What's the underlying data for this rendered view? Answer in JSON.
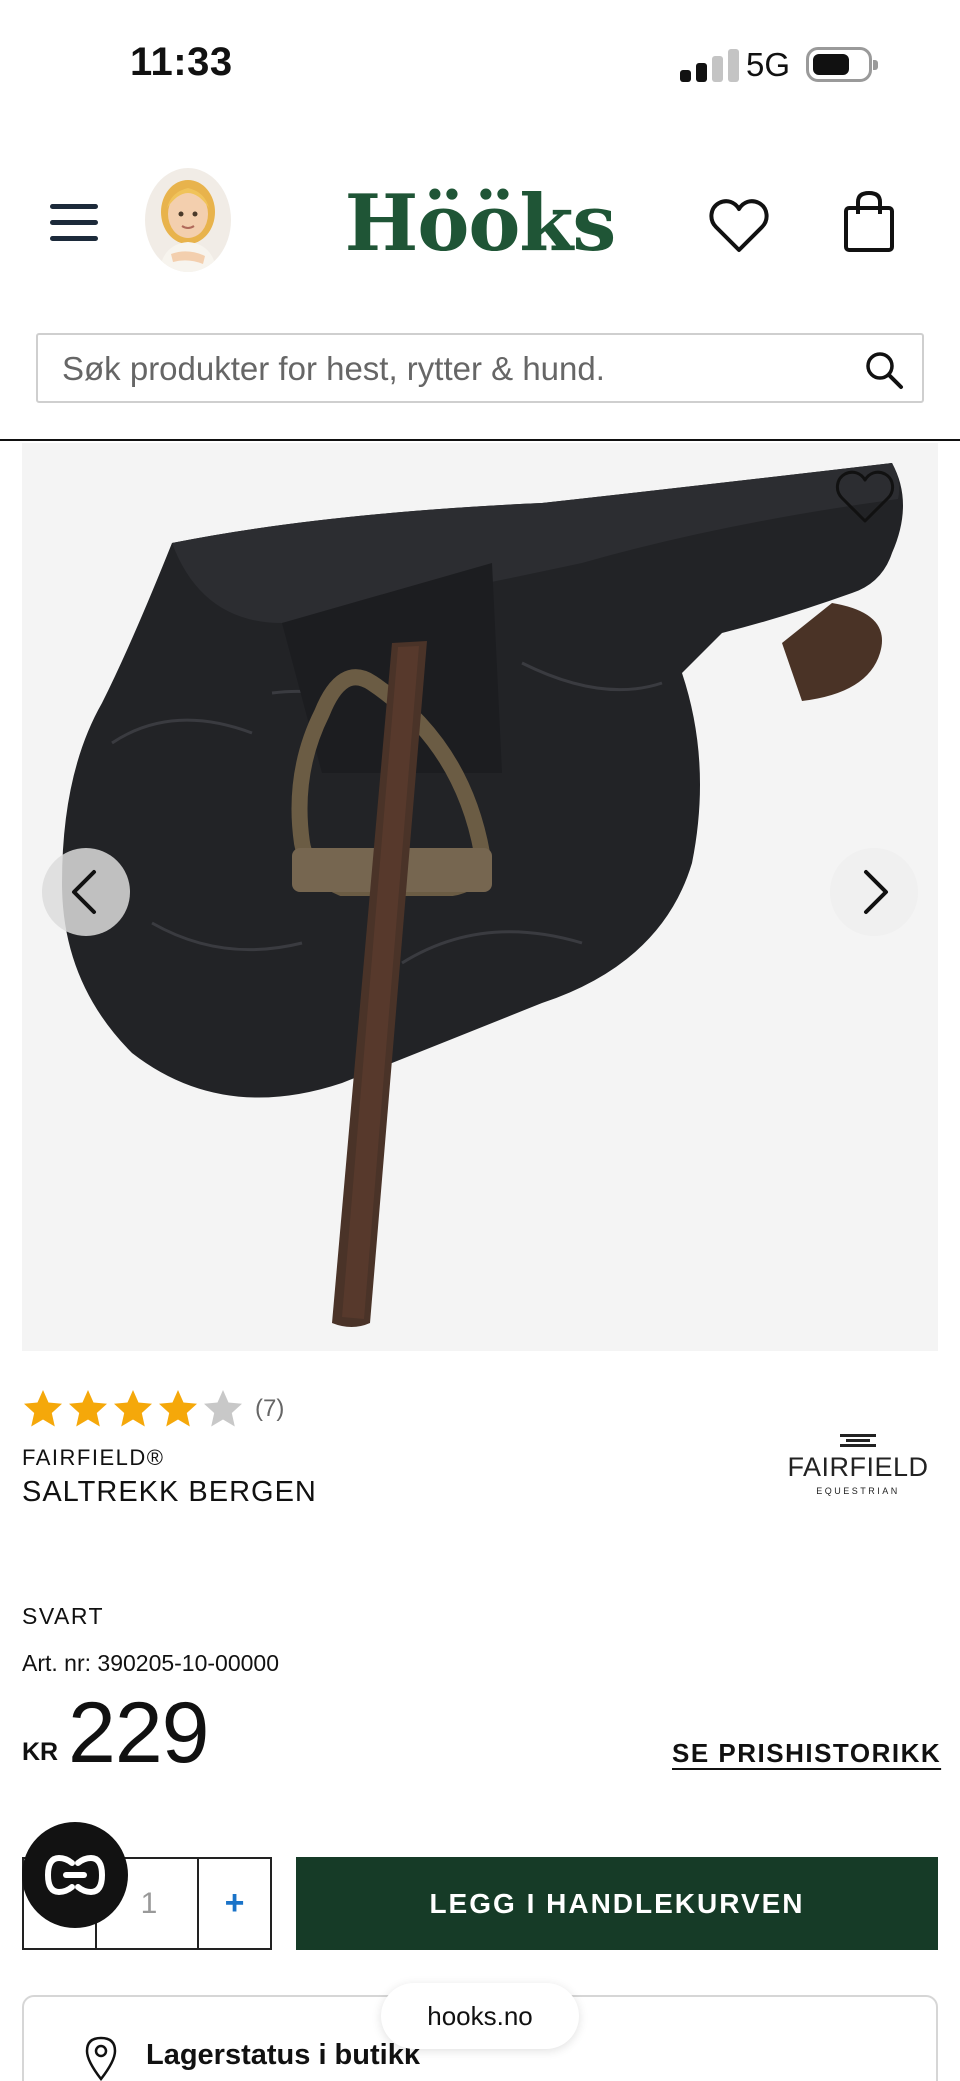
{
  "status_bar": {
    "time": "11:33",
    "network": "5G"
  },
  "header": {
    "logo_text": "Hööks",
    "menu_icon": "hamburger-menu-icon",
    "wishlist_icon": "heart-icon",
    "cart_icon": "shopping-bag-icon"
  },
  "search": {
    "placeholder": "Søk produkter for hest, rytter & hund.",
    "icon": "search-icon"
  },
  "product": {
    "rating": 4,
    "rating_max": 5,
    "review_count": "(7)",
    "brand": "FAIRFIELD®",
    "title": "SALTREKK BERGEN",
    "brand_logo_word": "FAIRFIELD",
    "brand_logo_sub": "EQUESTRIAN",
    "color": "SVART",
    "article_number": "Art. nr: 390205-10-00000",
    "currency": "KR",
    "price": "229",
    "price_history_link": "SE PRISHISTORIKK"
  },
  "cart": {
    "quantity": "1",
    "plus_label": "+",
    "add_to_cart_label": "LEGG I HANDLEKURVEN"
  },
  "stock": {
    "label": "Lagerstatus i butikk"
  },
  "browser": {
    "url": "hooks.no"
  },
  "colors": {
    "brand_green": "#1f5536",
    "cta_green": "#163b27",
    "star": "#f5a80a",
    "star_empty": "#c8c8c8",
    "plus_blue": "#1a73c8"
  }
}
